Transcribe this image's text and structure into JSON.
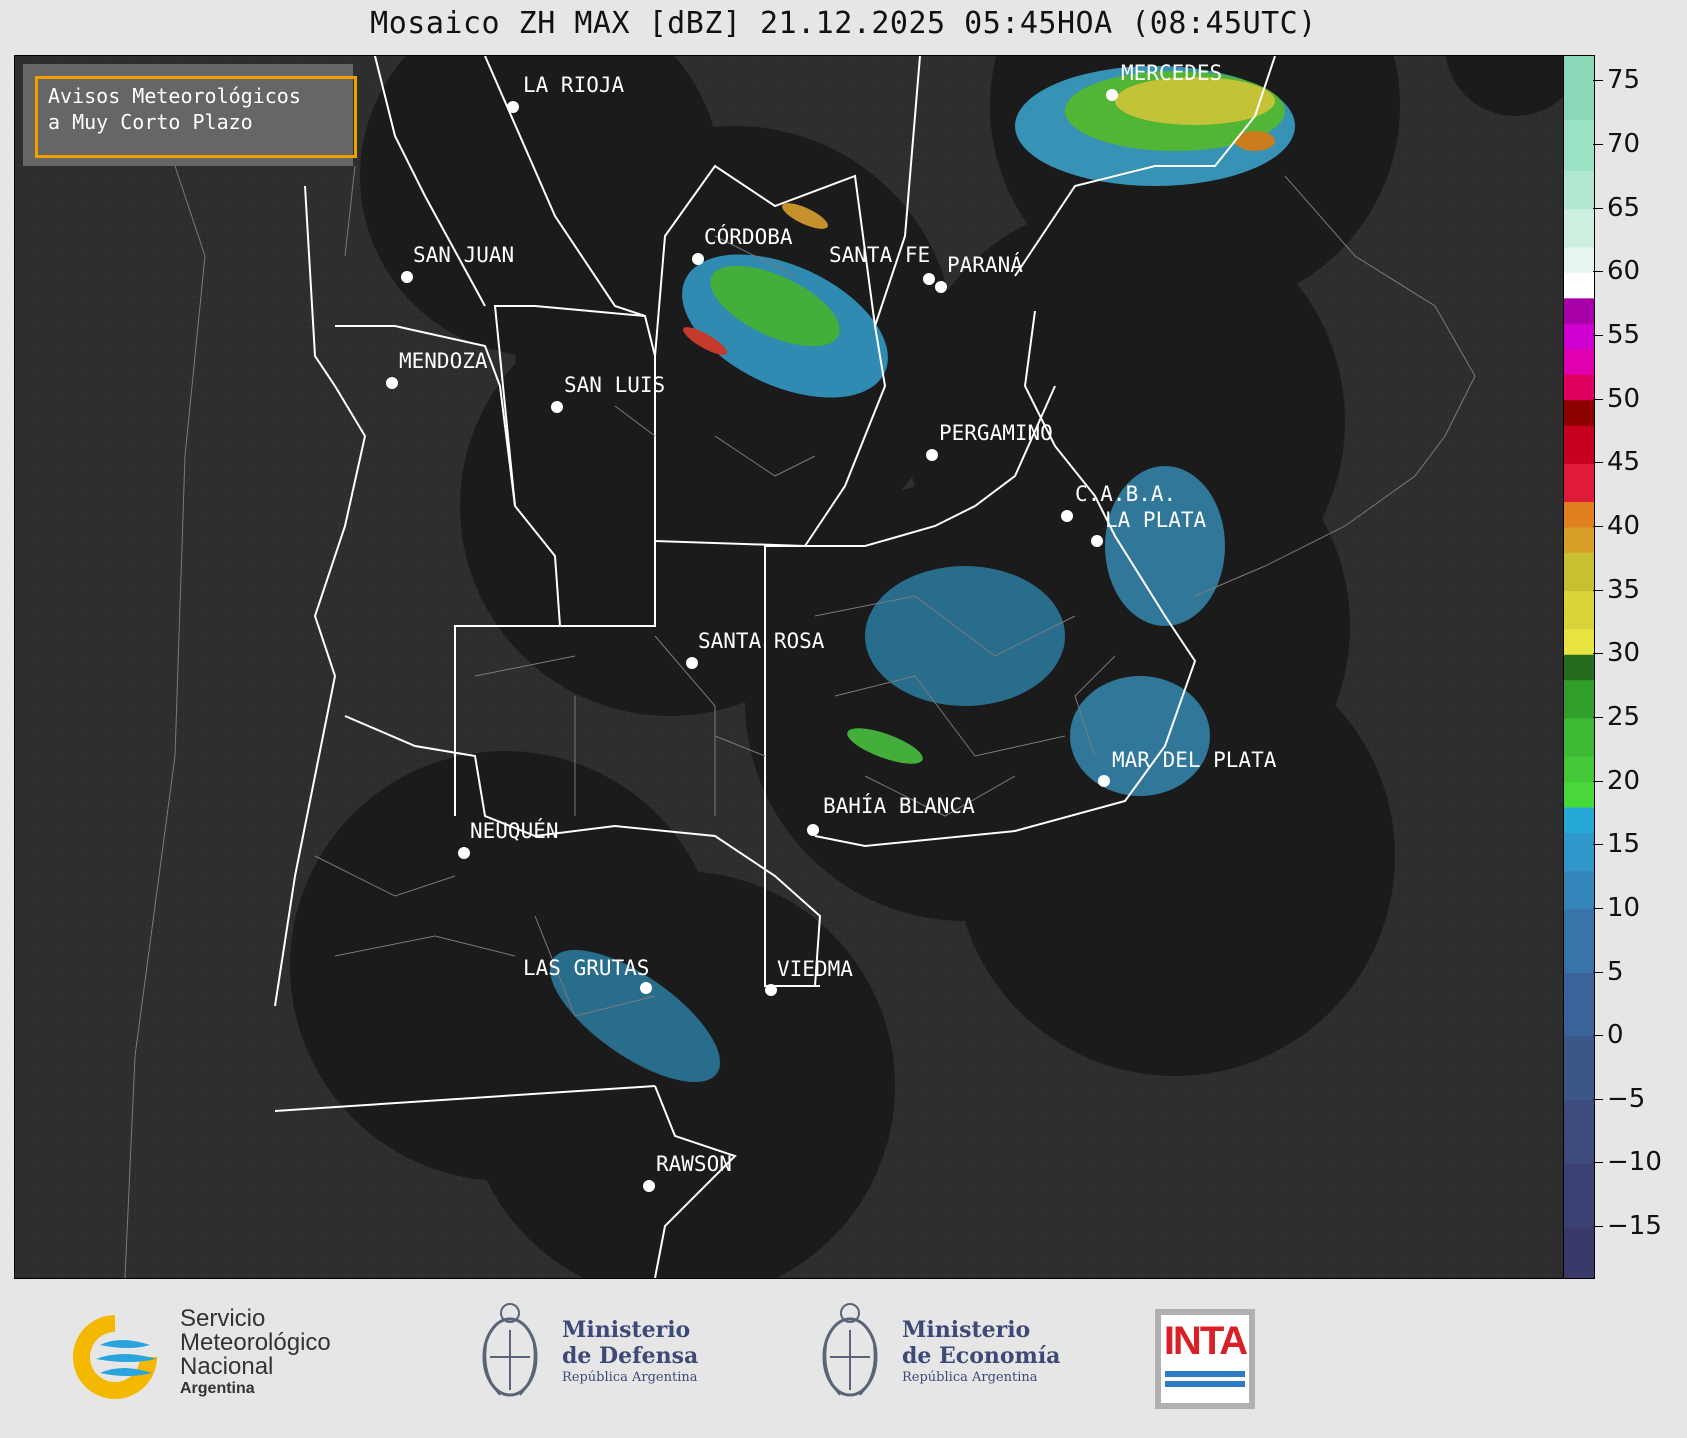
{
  "title": "Mosaico ZH MAX [dBZ] 21.12.2025 05:45HOA (08:45UTC)",
  "notice": {
    "line1": "Avisos Meteorológicos",
    "line2": "a Muy Corto Plazo",
    "border_color": "#f0a000"
  },
  "map": {
    "background_color": "#2d2d2d",
    "radar_coverage_color": "#1b1b1b",
    "cities": [
      {
        "name": "LA RIOJA"
      },
      {
        "name": "SAN JUAN"
      },
      {
        "name": "CÓRDOBA"
      },
      {
        "name": "SANTA FE"
      },
      {
        "name": "PARANÁ"
      },
      {
        "name": "MENDOZA"
      },
      {
        "name": "SAN LUIS"
      },
      {
        "name": "MERCEDES"
      },
      {
        "name": "PERGAMINO"
      },
      {
        "name": "C.A.B.A."
      },
      {
        "name": "LA PLATA"
      },
      {
        "name": "SANTA ROSA"
      },
      {
        "name": "MAR DEL PLATA"
      },
      {
        "name": "BAHÍA BLANCA"
      },
      {
        "name": "NEUQUÉN"
      },
      {
        "name": "LAS GRUTAS"
      },
      {
        "name": "VIEDMA"
      },
      {
        "name": "RAWSON"
      }
    ]
  },
  "colorbar": {
    "unit": "dBZ",
    "min": -19,
    "max": 77,
    "ticks": [
      "75",
      "70",
      "65",
      "60",
      "55",
      "50",
      "45",
      "40",
      "35",
      "30",
      "25",
      "20",
      "15",
      "10",
      "5",
      "0",
      "−5",
      "−10",
      "−15"
    ],
    "tick_values": [
      75,
      70,
      65,
      60,
      55,
      50,
      45,
      40,
      35,
      30,
      25,
      20,
      15,
      10,
      5,
      0,
      -5,
      -10,
      -15
    ]
  },
  "logos": {
    "smn": {
      "line1": "Servicio",
      "line2": "Meteorológico",
      "line3": "Nacional",
      "line4": "Argentina"
    },
    "defensa": {
      "line1": "Ministerio",
      "line2": "de Defensa",
      "line3": "República Argentina"
    },
    "economia": {
      "line1": "Ministerio",
      "line2": "de Economía",
      "line3": "República Argentina"
    },
    "inta": {
      "text": "INTA"
    }
  }
}
